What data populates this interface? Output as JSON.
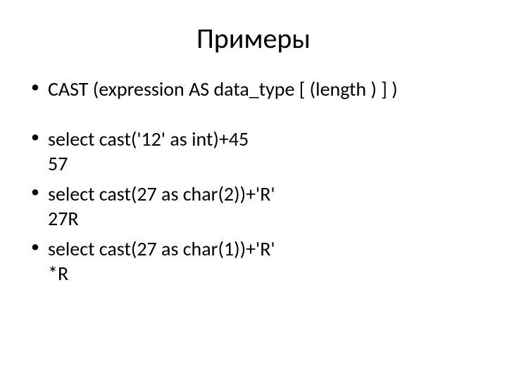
{
  "title": "Примеры",
  "bullets": [
    {
      "line": "CAST (expression AS data_type [ (length ) ] )",
      "result": null
    },
    null,
    {
      "line": "select cast('12' as int)+45",
      "result": "57"
    },
    {
      "line": "select cast(27 as char(2))+'R'",
      "result": "27R"
    },
    {
      "line": "select cast(27 as char(1))+'R'",
      "result": "*R"
    }
  ]
}
